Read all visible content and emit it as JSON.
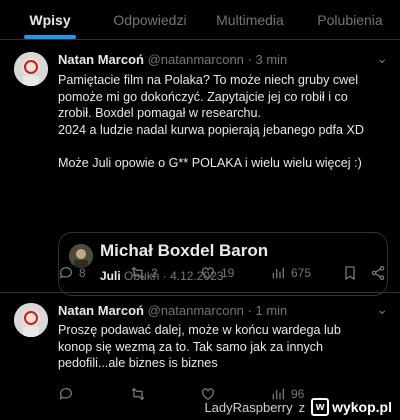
{
  "tabs": [
    {
      "label": "Wpisy",
      "active": true
    },
    {
      "label": "Odpowiedzi",
      "active": false
    },
    {
      "label": "Multimedia",
      "active": false
    },
    {
      "label": "Polubienia",
      "active": false
    }
  ],
  "posts": [
    {
      "author_name": "Natan Marcoń",
      "handle": "@natanmarconn",
      "time": "3 min",
      "lines": [
        "Pamiętacie film na Polaka? To może niech gruby cwel",
        "pomoże mi go dokończyć. Zapytajcie jej co robił i co",
        "zrobił. Boxdel pomagał w researchu.",
        "2024 a ludzie nadal kurwa popierają jebanego pdfa XD",
        "",
        "Może Juli opowie o G** POLAKA i wielu wielu więcej :)"
      ],
      "quote": {
        "title": "Michał Boxdel Baron",
        "author": "Juli",
        "handle": "Obukh",
        "date": "4.12.2023"
      },
      "actions": {
        "replies": "8",
        "reposts": "2",
        "likes": "19",
        "views": "675"
      }
    },
    {
      "author_name": "Natan Marcoń",
      "handle": "@natanmarconn",
      "time": "1 min",
      "lines": [
        "Proszę podawać dalej, może w końcu wardega lub",
        "konop się wezmą za to. Tak samo jak za innych",
        "pedofili...ale biznes is biznes"
      ],
      "actions": {
        "replies": "",
        "reposts": "",
        "likes": "",
        "views": "96"
      }
    }
  ],
  "footer": {
    "user": "LadyRaspberry",
    "z": "z",
    "site": "wykop.pl"
  },
  "colors": {
    "background": "#000000",
    "text": "#e7e9ea",
    "muted": "#71767b",
    "accent": "#1d9bf0",
    "border": "#2f3336"
  }
}
